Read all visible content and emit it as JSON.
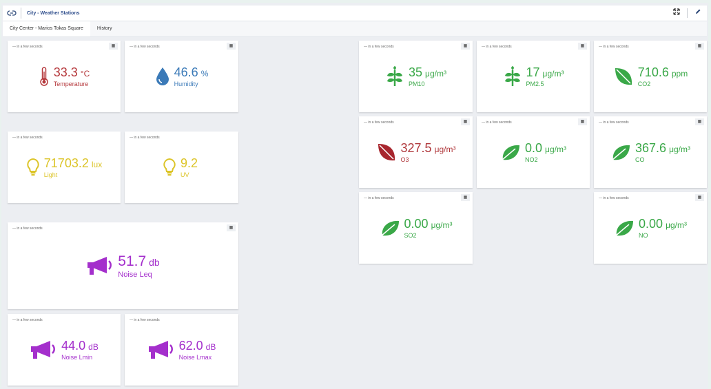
{
  "header": {
    "title": "City - Weather Stations",
    "tabs": [
      "City Center - Marios Tokas Square",
      "History"
    ]
  },
  "colors": {
    "temperature": "#b5383c",
    "humidity": "#3b7ab8",
    "light": "#dcc428",
    "noise": "#a42fcc",
    "good": "#3aa848",
    "bad": "#a8262e",
    "o3": "#b0383c"
  },
  "icons": {
    "thermometer": "thermometer-icon",
    "drop": "water-drop-icon",
    "bulb": "lightbulb-icon",
    "megaphone": "megaphone-icon",
    "plant": "plant-icon",
    "leaf": "leaf-icon"
  },
  "cards": [
    {
      "timestamp": "— in a few seconds",
      "value": "33.3",
      "unit": "°C",
      "label": "Temperature"
    },
    {
      "timestamp": "— in a few seconds",
      "value": "46.6",
      "unit": "%",
      "label": "Humidity"
    },
    {
      "timestamp": "— in a few seconds",
      "value": "71703.2",
      "unit": "lux",
      "label": "Light"
    },
    {
      "timestamp": "— in a few seconds",
      "value": "9.2",
      "unit": "",
      "label": "UV"
    },
    {
      "timestamp": "— in a few seconds",
      "value": "51.7",
      "unit": "db",
      "label": "Noise Leq"
    },
    {
      "timestamp": "— in a few seconds",
      "value": "44.0",
      "unit": "dB",
      "label": "Noise Lmin"
    },
    {
      "timestamp": "— in a few seconds",
      "value": "62.0",
      "unit": "dB",
      "label": "Noise Lmax"
    },
    {
      "timestamp": "— in a few seconds",
      "value": "35",
      "unit": "μg/m³",
      "label": "PM10"
    },
    {
      "timestamp": "— in a few seconds",
      "value": "17",
      "unit": "μg/m³",
      "label": "PM2.5"
    },
    {
      "timestamp": "— in a few seconds",
      "value": "710.6",
      "unit": "ppm",
      "label": "CO2"
    },
    {
      "timestamp": "— in a few seconds",
      "value": "327.5",
      "unit": "μg/m³",
      "label": "O3"
    },
    {
      "timestamp": "— in a few seconds",
      "value": "0.0",
      "unit": "μg/m³",
      "label": "NO2"
    },
    {
      "timestamp": "— in a few seconds",
      "value": "367.6",
      "unit": "μg/m³",
      "label": "CO"
    },
    {
      "timestamp": "— in a few seconds",
      "value": "0.00",
      "unit": "μg/m³",
      "label": "SO2"
    },
    {
      "timestamp": "— in a few seconds",
      "value": "0.00",
      "unit": "μg/m³",
      "label": "NO"
    }
  ]
}
